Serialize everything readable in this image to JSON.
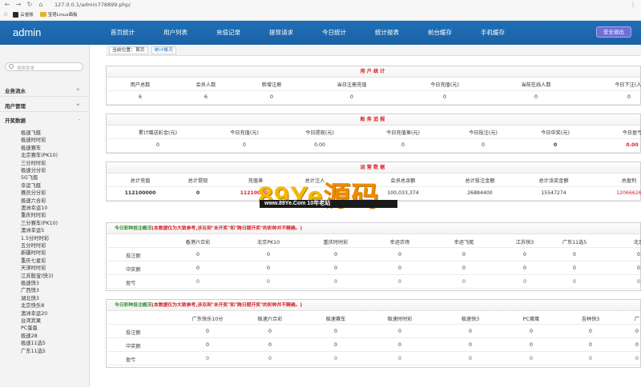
{
  "browser": {
    "url": "127.0.0.1/admin778899.php/",
    "bookmarks": [
      "云雀帐",
      "宝塔Linux面板"
    ]
  },
  "header": {
    "brand": "admin",
    "nav": [
      "首页统计",
      "用户列表",
      "充值记录",
      "提现请求",
      "今日统计",
      "统计报表",
      "前台缓存",
      "手机缓存"
    ],
    "logout": "安全退出"
  },
  "breadcrumb": {
    "location": "当前位置：首页",
    "active": "统计概况"
  },
  "sidebar": {
    "search_placeholder": "搜索菜单",
    "groups": [
      {
        "label": "业务流水",
        "toggle": "+"
      },
      {
        "label": "用户管理",
        "toggle": "+"
      },
      {
        "label": "开奖数据",
        "toggle": "-"
      }
    ],
    "items": [
      "极速飞艇",
      "极速时时彩",
      "极速赛车",
      "北京赛车(PK10)",
      "三分时时彩",
      "极速分分彩",
      "5G飞艇",
      "幸运飞艇",
      "赛员分分彩",
      "极速六合彩",
      "澳洲幸运10",
      "重庆时时彩",
      "三分赛车(PK10)",
      "澳洲幸运5",
      "1.5分时时彩",
      "五分时时彩",
      "新疆时时彩",
      "重庆七星彩",
      "天津时时彩",
      "江苏骰宝(快3)",
      "极速快3",
      "广西快3",
      "湖北快3",
      "北京快乐8",
      "澳洲幸运20",
      "台湾宾果",
      "PC蛋蛋",
      "极速28",
      "极速11选5",
      "广东11选5"
    ]
  },
  "user_stats": {
    "title": "用户统计",
    "headers": [
      "用户总数",
      "会员人数",
      "新增注册",
      "当日注册充值",
      "今日充值(元)",
      "当前在线人数",
      "今日下注(人)"
    ],
    "values": [
      "6",
      "6",
      "0",
      "0",
      "0",
      "0",
      "0"
    ]
  },
  "finance": {
    "title": "账务追报",
    "headers": [
      "累计赠送彩金(元)",
      "今日充值(元)",
      "今日提现(元)",
      "今日充值差(元)",
      "今日投注(元)",
      "今日中奖(元)",
      "今日盈亏"
    ],
    "values": [
      "0",
      "0",
      "0.00",
      "0",
      "0",
      "0",
      "0.00"
    ]
  },
  "operations": {
    "title": "运营数据",
    "headers": [
      "总计充值",
      "总计提现",
      "充值差",
      "总计注人",
      "会员总余额",
      "总计投注金额",
      "总计派奖金额",
      "总盈利"
    ],
    "values": [
      "112100000",
      "0",
      "112100000",
      "",
      "100,033,374",
      "26884400",
      "15547274",
      "12066626"
    ]
  },
  "betting1": {
    "title": "今日彩种投注概况",
    "note": "(本数据仅为大致参考,涉及到\"未开奖\"和\"跨日期开奖\"的彩种并不精确。)",
    "columns": [
      "香港六合彩",
      "北京PK10",
      "重庆时时彩",
      "幸运农场",
      "幸运飞艇",
      "江苏快3",
      "广东11选5",
      "北京"
    ],
    "rows": [
      {
        "label": "投注额",
        "values": [
          "0",
          "0",
          "0",
          "0",
          "0",
          "0",
          "0",
          "0"
        ]
      },
      {
        "label": "中奖额",
        "values": [
          "0",
          "0",
          "0",
          "0",
          "0",
          "0",
          "0",
          "0"
        ]
      },
      {
        "label": "盈亏",
        "values": [
          "0",
          "0",
          "0",
          "0",
          "0",
          "0",
          "0",
          "0"
        ]
      }
    ]
  },
  "betting2": {
    "title": "今日彩种投注概况",
    "note": "(本数据仅为大致参考,涉及到\"未开奖\"和\"跨日期开奖\"的彩种并不精确。)",
    "columns": [
      "广东快乐10分",
      "极速六合彩",
      "极速赛车",
      "极速时时彩",
      "极速快3",
      "PC蛋蛋",
      "吉林快3",
      "广"
    ],
    "rows": [
      {
        "label": "投注额",
        "values": [
          "0",
          "0",
          "0",
          "0",
          "0",
          "0",
          "0",
          "0"
        ]
      },
      {
        "label": "中奖额",
        "values": [
          "0",
          "0",
          "0",
          "0",
          "0",
          "0",
          "0",
          "0"
        ]
      },
      {
        "label": "盈亏",
        "values": [
          "0",
          "0",
          "0",
          "0",
          "0",
          "0",
          "0",
          "0"
        ]
      }
    ]
  },
  "watermark": {
    "logo_latin": "89Ye",
    "logo_cn": "源码",
    "strip": "www.89Ye.Com   10年老站"
  }
}
